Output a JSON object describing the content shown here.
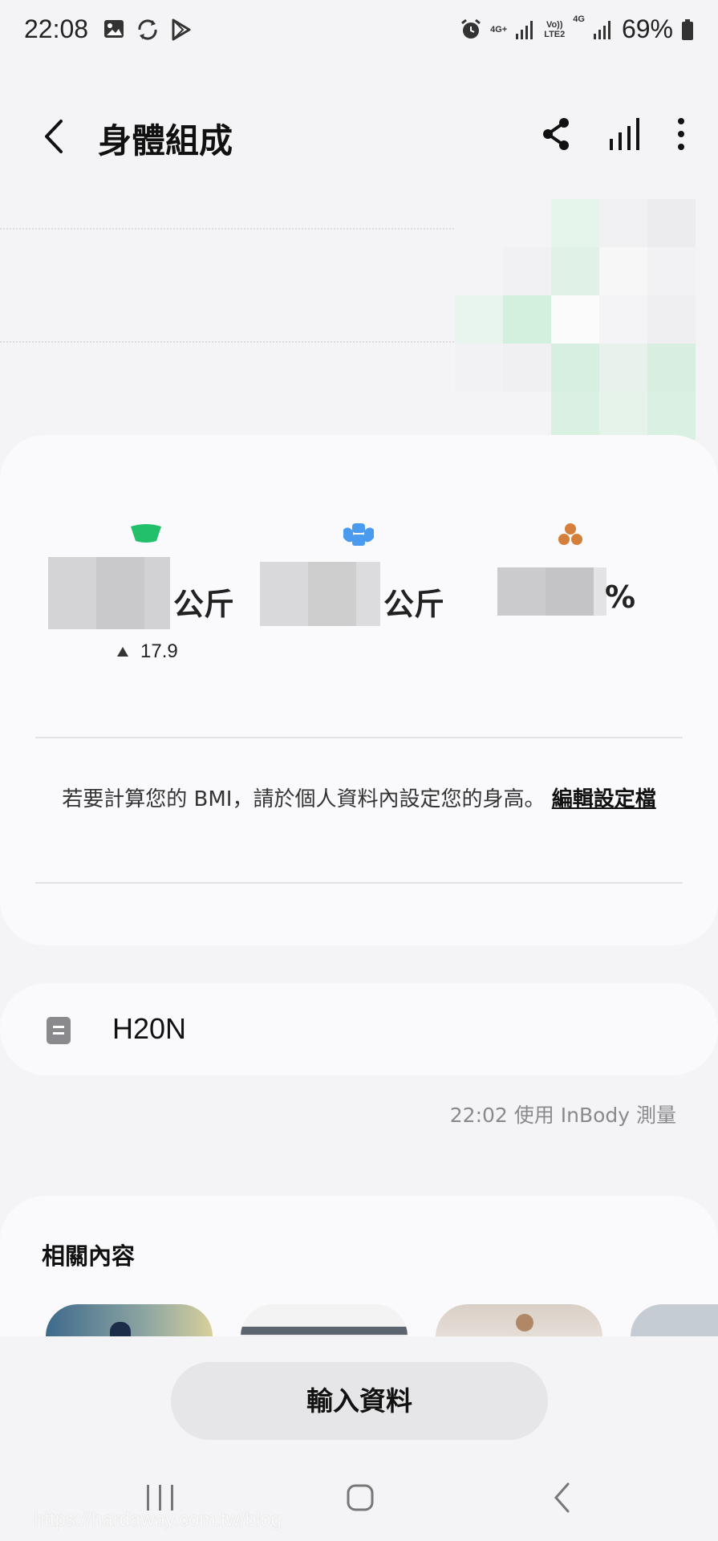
{
  "status_bar": {
    "time": "22:08",
    "net1": "4G+",
    "volte": "Vo))",
    "lte": "LTE2",
    "net2": "4G",
    "battery": "69%"
  },
  "header": {
    "title": "身體組成"
  },
  "metrics": [
    {
      "icon": "scale-icon",
      "unit": "公斤",
      "delta": "17.9",
      "color": "#22c06a"
    },
    {
      "icon": "muscle-icon",
      "unit": "公斤",
      "color": "#4a9af0"
    },
    {
      "icon": "body-fat-icon",
      "unit": "%",
      "color": "#d4803a"
    }
  ],
  "bmi": {
    "message": "若要計算您的 BMI，請於個人資料內設定您的身高。",
    "link": "編輯設定檔"
  },
  "device": {
    "name": "H20N"
  },
  "measurement": {
    "text": "22:02 使用 InBody 測量"
  },
  "related": {
    "title": "相關內容"
  },
  "input_button": {
    "label": "輸入資料"
  },
  "watermark": "https://hardaway.com.tw/blog"
}
